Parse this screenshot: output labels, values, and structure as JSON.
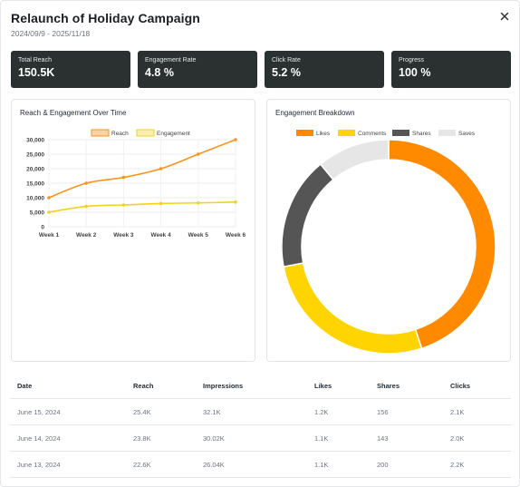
{
  "header": {
    "title": "Relaunch of Holiday Campaign",
    "date_range": "2024/09/9 - 2025/11/18"
  },
  "stats": [
    {
      "label": "Total Reach",
      "value": "150.5K"
    },
    {
      "label": "Engagement Rate",
      "value": "4.8 %"
    },
    {
      "label": "Click Rate",
      "value": "5.2 %"
    },
    {
      "label": "Progress",
      "value": "100 %"
    }
  ],
  "icons": {
    "close": "close-icon"
  },
  "colors": {
    "reach": "#f7941d",
    "engagement": "#f2d31b",
    "likes": "#ff8a00",
    "comments": "#ffd400",
    "shares": "#555555",
    "saves": "#e6e6e6",
    "stat_bg": "#2b3131"
  },
  "line_card": {
    "title": "Reach & Engagement Over Time"
  },
  "donut_card": {
    "title": "Engagement Breakdown"
  },
  "chart_data": [
    {
      "type": "line",
      "title": "Reach & Engagement Over Time",
      "categories": [
        "Week 1",
        "Week 2",
        "Week 3",
        "Week 4",
        "Week 5",
        "Week 6"
      ],
      "series": [
        {
          "name": "Reach",
          "values": [
            10000,
            15000,
            17000,
            20000,
            25000,
            30000
          ]
        },
        {
          "name": "Engagement",
          "values": [
            5000,
            7000,
            7500,
            8000,
            8200,
            8500
          ]
        }
      ],
      "yticks": [
        "30,000",
        "25,000",
        "20,000",
        "15,000",
        "10,000",
        "5,000",
        "0"
      ],
      "ylim": [
        0,
        30000
      ],
      "grid": true,
      "legend": "top"
    },
    {
      "type": "pie",
      "title": "Engagement Breakdown",
      "labels": [
        "Likes",
        "Comments",
        "Shares",
        "Saves"
      ],
      "values": [
        45,
        27,
        17,
        11
      ],
      "donut": true,
      "legend": "top"
    }
  ],
  "table": {
    "columns": [
      "Date",
      "Reach",
      "Impressions",
      "Likes",
      "Shares",
      "Clicks"
    ],
    "rows": [
      [
        "June 15, 2024",
        "25.4K",
        "32.1K",
        "1.2K",
        "156",
        "2.1K"
      ],
      [
        "June 14, 2024",
        "23.8K",
        "30.02K",
        "1.1K",
        "143",
        "2.0K"
      ],
      [
        "June 13, 2024",
        "22.6K",
        "26.04K",
        "1.1K",
        "200",
        "2.2K"
      ]
    ]
  }
}
